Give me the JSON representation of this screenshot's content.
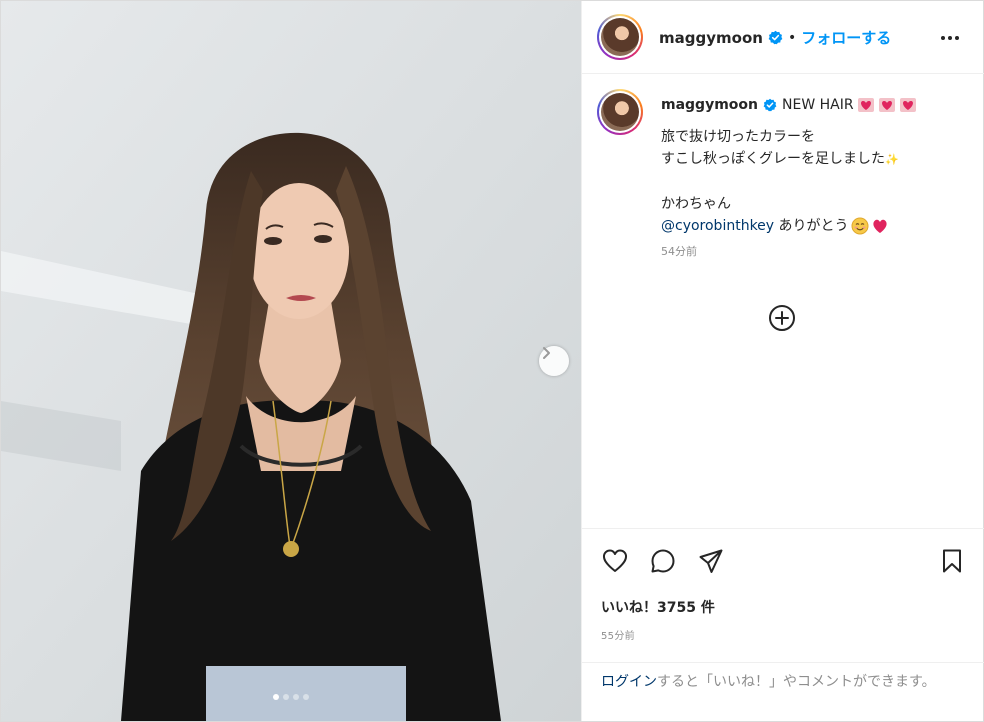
{
  "post": {
    "username": "maggymoon",
    "follow_label": "フォローする",
    "separator": "•",
    "caption": {
      "title": "NEW HAIR",
      "line1": "旅で抜け切ったカラーを",
      "line2": "すこし秋っぽくグレーを足しました",
      "line3": "かわちゃん",
      "mention": "@cyorobinthkey",
      "line4_suffix": " ありがとう",
      "time_ago": "54分前"
    },
    "likes_text": "いいね！3755 件",
    "posted_time": "55分前",
    "login_prompt": {
      "link": "ログイン",
      "rest": "すると「いいね！」やコメントができます。"
    },
    "carousel": {
      "total": 4,
      "current": 1
    },
    "icons": {
      "more": "more-options-icon",
      "like": "heart-icon",
      "comment": "comment-icon",
      "share": "share-icon",
      "save": "bookmark-icon",
      "add": "add-circle-icon",
      "next": "chevron-right-icon",
      "verified": "verified-badge-icon"
    },
    "colors": {
      "accent": "#0095f6",
      "verified": "#0095f6",
      "text": "#262626",
      "muted": "#8e8e8e",
      "link": "#00376b",
      "heart_emoji": "#e0245e"
    }
  }
}
